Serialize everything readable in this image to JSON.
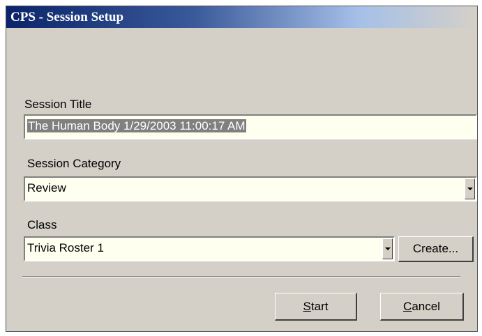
{
  "window": {
    "title": "CPS - Session Setup"
  },
  "session_title": {
    "label": "Session Title",
    "value": "The Human Body 1/29/2003 11:00:17 AM"
  },
  "session_category": {
    "label": "Session Category",
    "selected": "Review"
  },
  "class": {
    "label": "Class",
    "selected": "Trivia Roster 1",
    "create_button": "Create..."
  },
  "buttons": {
    "start_underline": "S",
    "start_rest": "tart",
    "cancel_underline": "C",
    "cancel_rest": "ancel"
  }
}
